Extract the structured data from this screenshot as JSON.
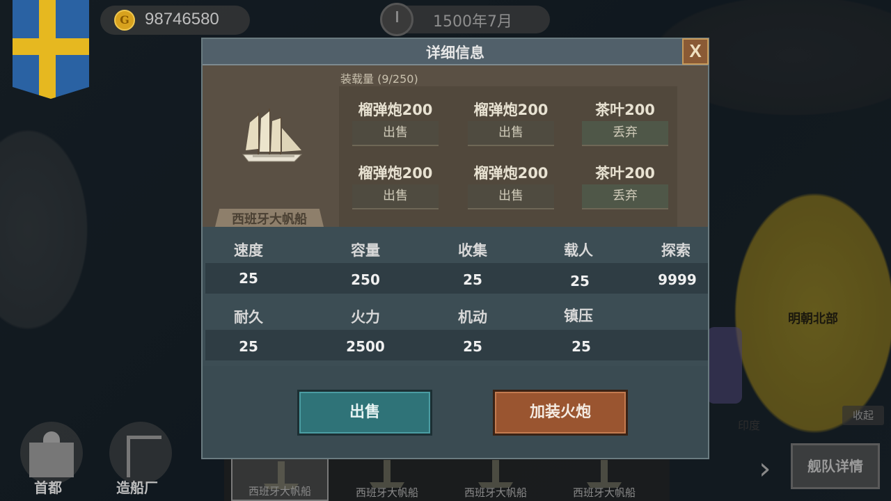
{
  "hud": {
    "gold": "98746580",
    "coin_symbol": "G",
    "date": "1500年7月"
  },
  "map": {
    "region_ming_north": "明朝北部",
    "region_india": "印度"
  },
  "bottom_nav": {
    "capital": "首都",
    "shipyard": "造船厂",
    "collapse": "收起",
    "fleet_detail": "舰队详情",
    "fleet_ships": [
      "西班牙大帆船",
      "西班牙大帆船",
      "西班牙大帆船",
      "西班牙大帆船"
    ]
  },
  "dialog": {
    "title": "详细信息",
    "close": "X",
    "ship_name": "西班牙大帆船",
    "cargo_title": "装载量 (9/250)",
    "cargo": [
      {
        "name": "榴弹炮200",
        "action": "出售"
      },
      {
        "name": "榴弹炮200",
        "action": "出售"
      },
      {
        "name": "茶叶200",
        "action": "丢弃"
      },
      {
        "name": "榴弹炮200",
        "action": "出售"
      },
      {
        "name": "榴弹炮200",
        "action": "出售"
      },
      {
        "name": "茶叶200",
        "action": "丢弃"
      }
    ],
    "stats_row1": [
      {
        "label": "速度",
        "value": "25"
      },
      {
        "label": "容量",
        "value": "250"
      },
      {
        "label": "收集",
        "value": "25"
      },
      {
        "label": "载人",
        "value": "25"
      },
      {
        "label": "探索",
        "value": "9999"
      }
    ],
    "stats_row2": [
      {
        "label": "耐久",
        "value": "25"
      },
      {
        "label": "火力",
        "value": "2500"
      },
      {
        "label": "机动",
        "value": "25"
      },
      {
        "label": "镇压",
        "value": "25"
      }
    ],
    "sell_button": "出售",
    "add_cannon_button": "加装火炮"
  },
  "colors": {
    "sell_accent": "#2f7378",
    "cannon_accent": "#9a5530",
    "flag_blue": "#2a62a3",
    "flag_yellow": "#e6b820"
  }
}
